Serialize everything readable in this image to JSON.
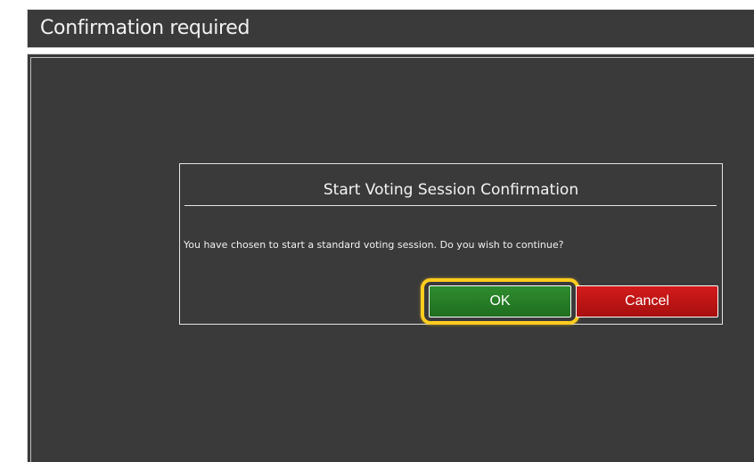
{
  "window": {
    "title": "Confirmation required"
  },
  "dialog": {
    "title": "Start Voting Session Confirmation",
    "message": "You have chosen to start a standard voting session. Do you wish to continue?",
    "ok_label": "OK",
    "cancel_label": "Cancel"
  },
  "colors": {
    "background": "#3a3a3a",
    "ok_button": "#2a7f2a",
    "cancel_button": "#c51414",
    "highlight": "#ffcc1f"
  }
}
